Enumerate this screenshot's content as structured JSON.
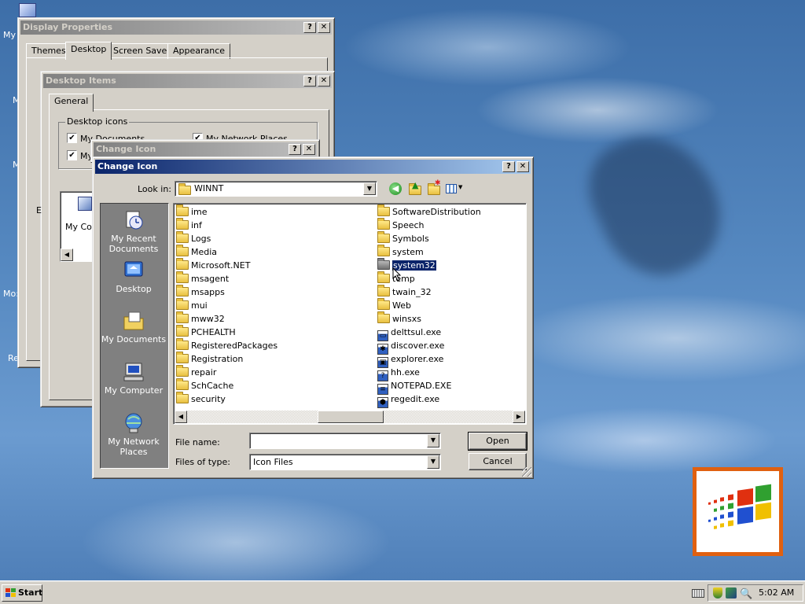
{
  "desktop": {
    "icon_labels": [
      "My",
      "M",
      "M",
      "Mo:",
      "Re"
    ]
  },
  "display_properties": {
    "title": "Display Properties",
    "tabs": [
      "Themes",
      "Desktop",
      "Screen Saver",
      "Appearance"
    ]
  },
  "desktop_items": {
    "title": "Desktop Items",
    "tab": "General",
    "group_label": "Desktop icons",
    "checkboxes": [
      "My Documents",
      "My Network Places",
      "My"
    ],
    "preview_label": "My Co",
    "side_letter": "E"
  },
  "change_icon_back": {
    "title": "Change Icon"
  },
  "change_icon": {
    "title": "Change Icon",
    "look_in_label": "Look in:",
    "look_in_value": "WINNT",
    "places": [
      "My Recent Documents",
      "Desktop",
      "My Documents",
      "My Computer",
      "My Network Places"
    ],
    "files_col1": [
      "ime",
      "inf",
      "Logs",
      "Media",
      "Microsoft.NET",
      "msagent",
      "msapps",
      "mui",
      "mww32",
      "PCHEALTH",
      "RegisteredPackages",
      "Registration",
      "repair",
      "SchCache",
      "security"
    ],
    "files_col2": [
      "SoftwareDistribution",
      "Speech",
      "Symbols",
      "system",
      "system32",
      "temp",
      "twain_32",
      "Web",
      "winsxs",
      "delttsul.exe",
      "discover.exe",
      "explorer.exe",
      "hh.exe",
      "NOTEPAD.EXE",
      "regedit.exe"
    ],
    "selected_item": "system32",
    "file_name_label": "File name:",
    "file_name_value": "",
    "files_of_type_label": "Files of type:",
    "files_of_type_value": "Icon Files",
    "open_label": "Open",
    "cancel_label": "Cancel"
  },
  "title_buttons": {
    "help": "?",
    "close": "✕"
  },
  "taskbar": {
    "start_label": "Start",
    "clock": "5:02 AM"
  },
  "colors": {
    "title_active": "#0a246a",
    "title_inactive": "#808080",
    "face": "#d4d0c8"
  }
}
